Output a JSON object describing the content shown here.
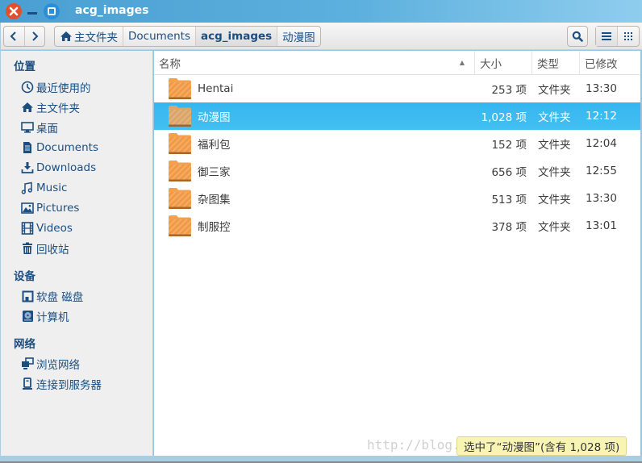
{
  "window": {
    "title": "acg_images"
  },
  "toolbar": {
    "back_icon": "chevron-left",
    "forward_icon": "chevron-right",
    "breadcrumbs": [
      {
        "label": "主文件夹",
        "icon": "home-icon"
      },
      {
        "label": "Documents"
      },
      {
        "label": "acg_images",
        "active": true
      },
      {
        "label": "动漫图"
      }
    ],
    "search_icon": "search-icon",
    "view_list_icon": "list-view-icon",
    "view_grid_icon": "grid-view-icon"
  },
  "sidebar": {
    "sections": [
      {
        "heading": "位置",
        "items": [
          {
            "label": "最近使用的",
            "icon": "clock-icon"
          },
          {
            "label": "主文件夹",
            "icon": "home-icon"
          },
          {
            "label": "桌面",
            "icon": "desktop-icon"
          },
          {
            "label": "Documents",
            "icon": "document-icon"
          },
          {
            "label": "Downloads",
            "icon": "download-icon"
          },
          {
            "label": "Music",
            "icon": "music-icon"
          },
          {
            "label": "Pictures",
            "icon": "picture-icon"
          },
          {
            "label": "Videos",
            "icon": "video-icon"
          },
          {
            "label": "回收站",
            "icon": "trash-icon"
          }
        ]
      },
      {
        "heading": "设备",
        "items": [
          {
            "label": "软盘 磁盘",
            "icon": "floppy-icon"
          },
          {
            "label": "计算机",
            "icon": "harddisk-icon"
          }
        ]
      },
      {
        "heading": "网络",
        "items": [
          {
            "label": "浏览网络",
            "icon": "network-icon"
          },
          {
            "label": "连接到服务器",
            "icon": "server-icon"
          }
        ]
      }
    ]
  },
  "file_list": {
    "columns": {
      "name": "名称",
      "size": "大小",
      "type": "类型",
      "modified": "已修改",
      "sort_indicator": "▲"
    },
    "rows": [
      {
        "name": "Hentai",
        "size": "253 项",
        "type": "文件夹",
        "modified": "13:30",
        "selected": false
      },
      {
        "name": "动漫图",
        "size": "1,028 项",
        "type": "文件夹",
        "modified": "12:12",
        "selected": true
      },
      {
        "name": "福利包",
        "size": "152 项",
        "type": "文件夹",
        "modified": "12:04",
        "selected": false
      },
      {
        "name": "御三家",
        "size": "656 项",
        "type": "文件夹",
        "modified": "12:55",
        "selected": false
      },
      {
        "name": "杂图集",
        "size": "513 项",
        "type": "文件夹",
        "modified": "13:30",
        "selected": false
      },
      {
        "name": "制服控",
        "size": "378 项",
        "type": "文件夹",
        "modified": "13:01",
        "selected": false
      }
    ]
  },
  "status": {
    "text": "选中了“动漫图”(含有 1,028 项)"
  },
  "watermark": {
    "text": "http://blog."
  },
  "colors": {
    "titlebar": "#4a9fd2",
    "selection": "#3bbaf0",
    "sidebar_text": "#1d4e80",
    "close_button": "#e0502b",
    "status_bg": "#f8f5b4"
  }
}
